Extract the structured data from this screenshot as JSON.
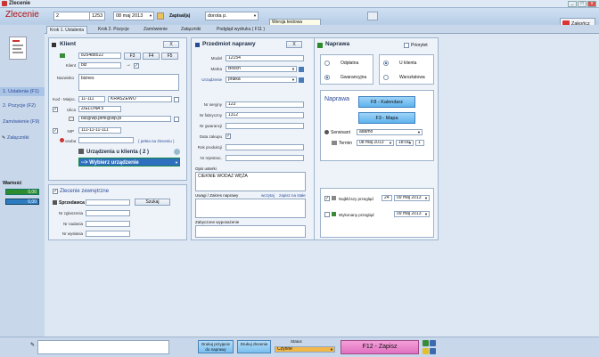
{
  "window": {
    "title": "Zlecenie"
  },
  "header": {
    "title": "Zlecenie",
    "number": "2",
    "code": "1253",
    "date": "08 maj 2013",
    "zapisal_label": "Zapisal(a)",
    "zapisal_value": "dorota p.",
    "warning": "Wersja testowa\ndo 15 sty 2013",
    "close_label": "Zakończ"
  },
  "sidebar": {
    "items": [
      "1. Ustalenia (F1)",
      "2. Pozycje (F2)",
      "Zamówienie (F9)",
      "Załączniki"
    ],
    "wartosc_label": "Wartość",
    "value1": "0,00",
    "value2": "0,00"
  },
  "tabs": [
    "Krok 1. Ustalenia",
    "Krok 2. Pozycje",
    "Zamówienie",
    "Załączniki",
    "Podgląd wydruku ( F11 )"
  ],
  "klient": {
    "title": "Klient",
    "x": "X",
    "phone": "825488522",
    "f3": "F3",
    "f4": "F4",
    "f5": "F5",
    "klient_label": "Klient",
    "klient_value": "biz",
    "nazwisko_label": "Nazwisko",
    "nazwisko_value": "biznes",
    "kod_label": "Kod - Miejsc.",
    "kod_value": "11-111",
    "miasto_value": "KRASZEWO",
    "ulica_label": "Ulica",
    "ulica_value": "ZIELONA 5",
    "email_value": "biz@wp.plmi@wp.pl",
    "nip_label": "NIP",
    "nip_value": "111-11-11-111",
    "osoba_label": "osoba",
    "pelna_label": "( pełna na zleceniu )",
    "urzadzenia_label": "Urządzenia u klienta ( 2 )",
    "wybierz_label": "--> Wybierz urządzenie"
  },
  "zewn": {
    "title": "Zlecenie zewnętrzne",
    "sprzedawca_label": "Sprzedawca",
    "szukaj_label": "Szukaj",
    "nr_zgl_label": "Nr zgłoszenia",
    "nr_nad_label": "Nr nadania",
    "nr_wys_label": "Nr wysłania"
  },
  "przedmiot": {
    "title": "Przedmiot naprawy",
    "x": "X",
    "model_label": "Model",
    "model_value": "12154",
    "marka_label": "Marka",
    "marka_value": "Bosch",
    "urzadzenie_label": "Urządzenie",
    "urzadzenie_value": "pralka",
    "nr_seryjny_label": "Nr seryjny",
    "nr_seryjny_value": "123",
    "nr_fabryczny_label": "Nr fabryczny",
    "nr_fabryczny_value": "1312",
    "nr_gwarancji_label": "Nr gwarancji",
    "data_zakupu_label": "Data zakupu",
    "rok_label": "Rok produkcji",
    "nr_rej_label": "Nr rejestrac.",
    "opis_label": "Opis usterki",
    "opis_value": "CIEKNIE WODAZ WĘŻA",
    "uwagi_label": "Uwagi / Zakres naprawy",
    "wcz_label": "wczytaj",
    "zapisz_label": "zapisz na stałe",
    "wyposazenie_label": "Zabyczone wyposażenie"
  },
  "naprawa": {
    "title": "Naprawa",
    "priorytet_label": "Priorytet",
    "odplatna": "Odpłatna",
    "gwarancyjna": "Gwarancyjna",
    "u_klienta": "U klienta",
    "warsztatowa": "Warsztatowa",
    "naprawa_label": "Naprawa",
    "f8_label": "F8 - Kalendarz",
    "f3_label": "F3 - Mapa",
    "serwisant_label": "Serwisant",
    "serwisant_value": "adamo",
    "termin_label": "Termin",
    "termin_date": "08 maj 2013",
    "termin_time": "18:00",
    "termin_n": "1",
    "najblizszy_label": "Najbliższy przegląd",
    "najblizszy_n": "24",
    "najblizszy_date": "09 maj 2013",
    "wykonany_label": "Wykonany przegląd",
    "wykonany_date": "09 maj 2013"
  },
  "bottom": {
    "druk_label": "Drukuj przyjęcie do naprawy",
    "drukuj_label": "Drukuj zlecenie",
    "status_label": "Status",
    "status_value": "Czynne",
    "save_label": "F12 - Zapisz"
  }
}
